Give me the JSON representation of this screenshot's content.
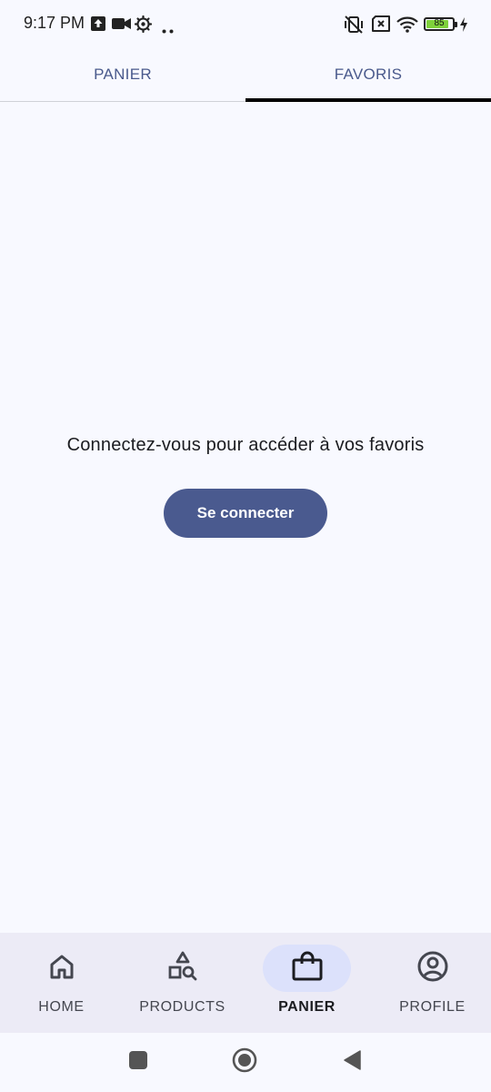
{
  "status_bar": {
    "time": "9:17 PM",
    "battery_level": "85",
    "battery_fraction": 0.85,
    "icons": [
      "upload-icon",
      "video-camera-icon",
      "settings-icon",
      "more-dots-icon",
      "vibrate-off-icon",
      "no-sim-icon",
      "wifi-icon",
      "battery-icon",
      "charging-icon"
    ]
  },
  "tabs": {
    "items": [
      {
        "label": "PANIER",
        "selected": false
      },
      {
        "label": "FAVORIS",
        "selected": true
      }
    ]
  },
  "main": {
    "message": "Connectez-vous pour accéder à vos favoris",
    "login_button": "Se connecter"
  },
  "bottom_nav": {
    "items": [
      {
        "label": "HOME",
        "icon": "home-icon",
        "active": false
      },
      {
        "label": "PRODUCTS",
        "icon": "products-icon",
        "active": false
      },
      {
        "label": "PANIER",
        "icon": "shopping-bag-icon",
        "active": true
      },
      {
        "label": "PROFILE",
        "icon": "profile-icon",
        "active": false
      }
    ]
  },
  "system_nav": {
    "icons": [
      "recents-icon",
      "home-circle-icon",
      "back-icon"
    ]
  },
  "colors": {
    "background": "#f8f9ff",
    "primary": "#4a5a8f",
    "nav_background": "#ecebf6",
    "active_pill": "#dce1fb",
    "tab_indicator": "#000000",
    "battery_fill": "#7fd13b"
  }
}
